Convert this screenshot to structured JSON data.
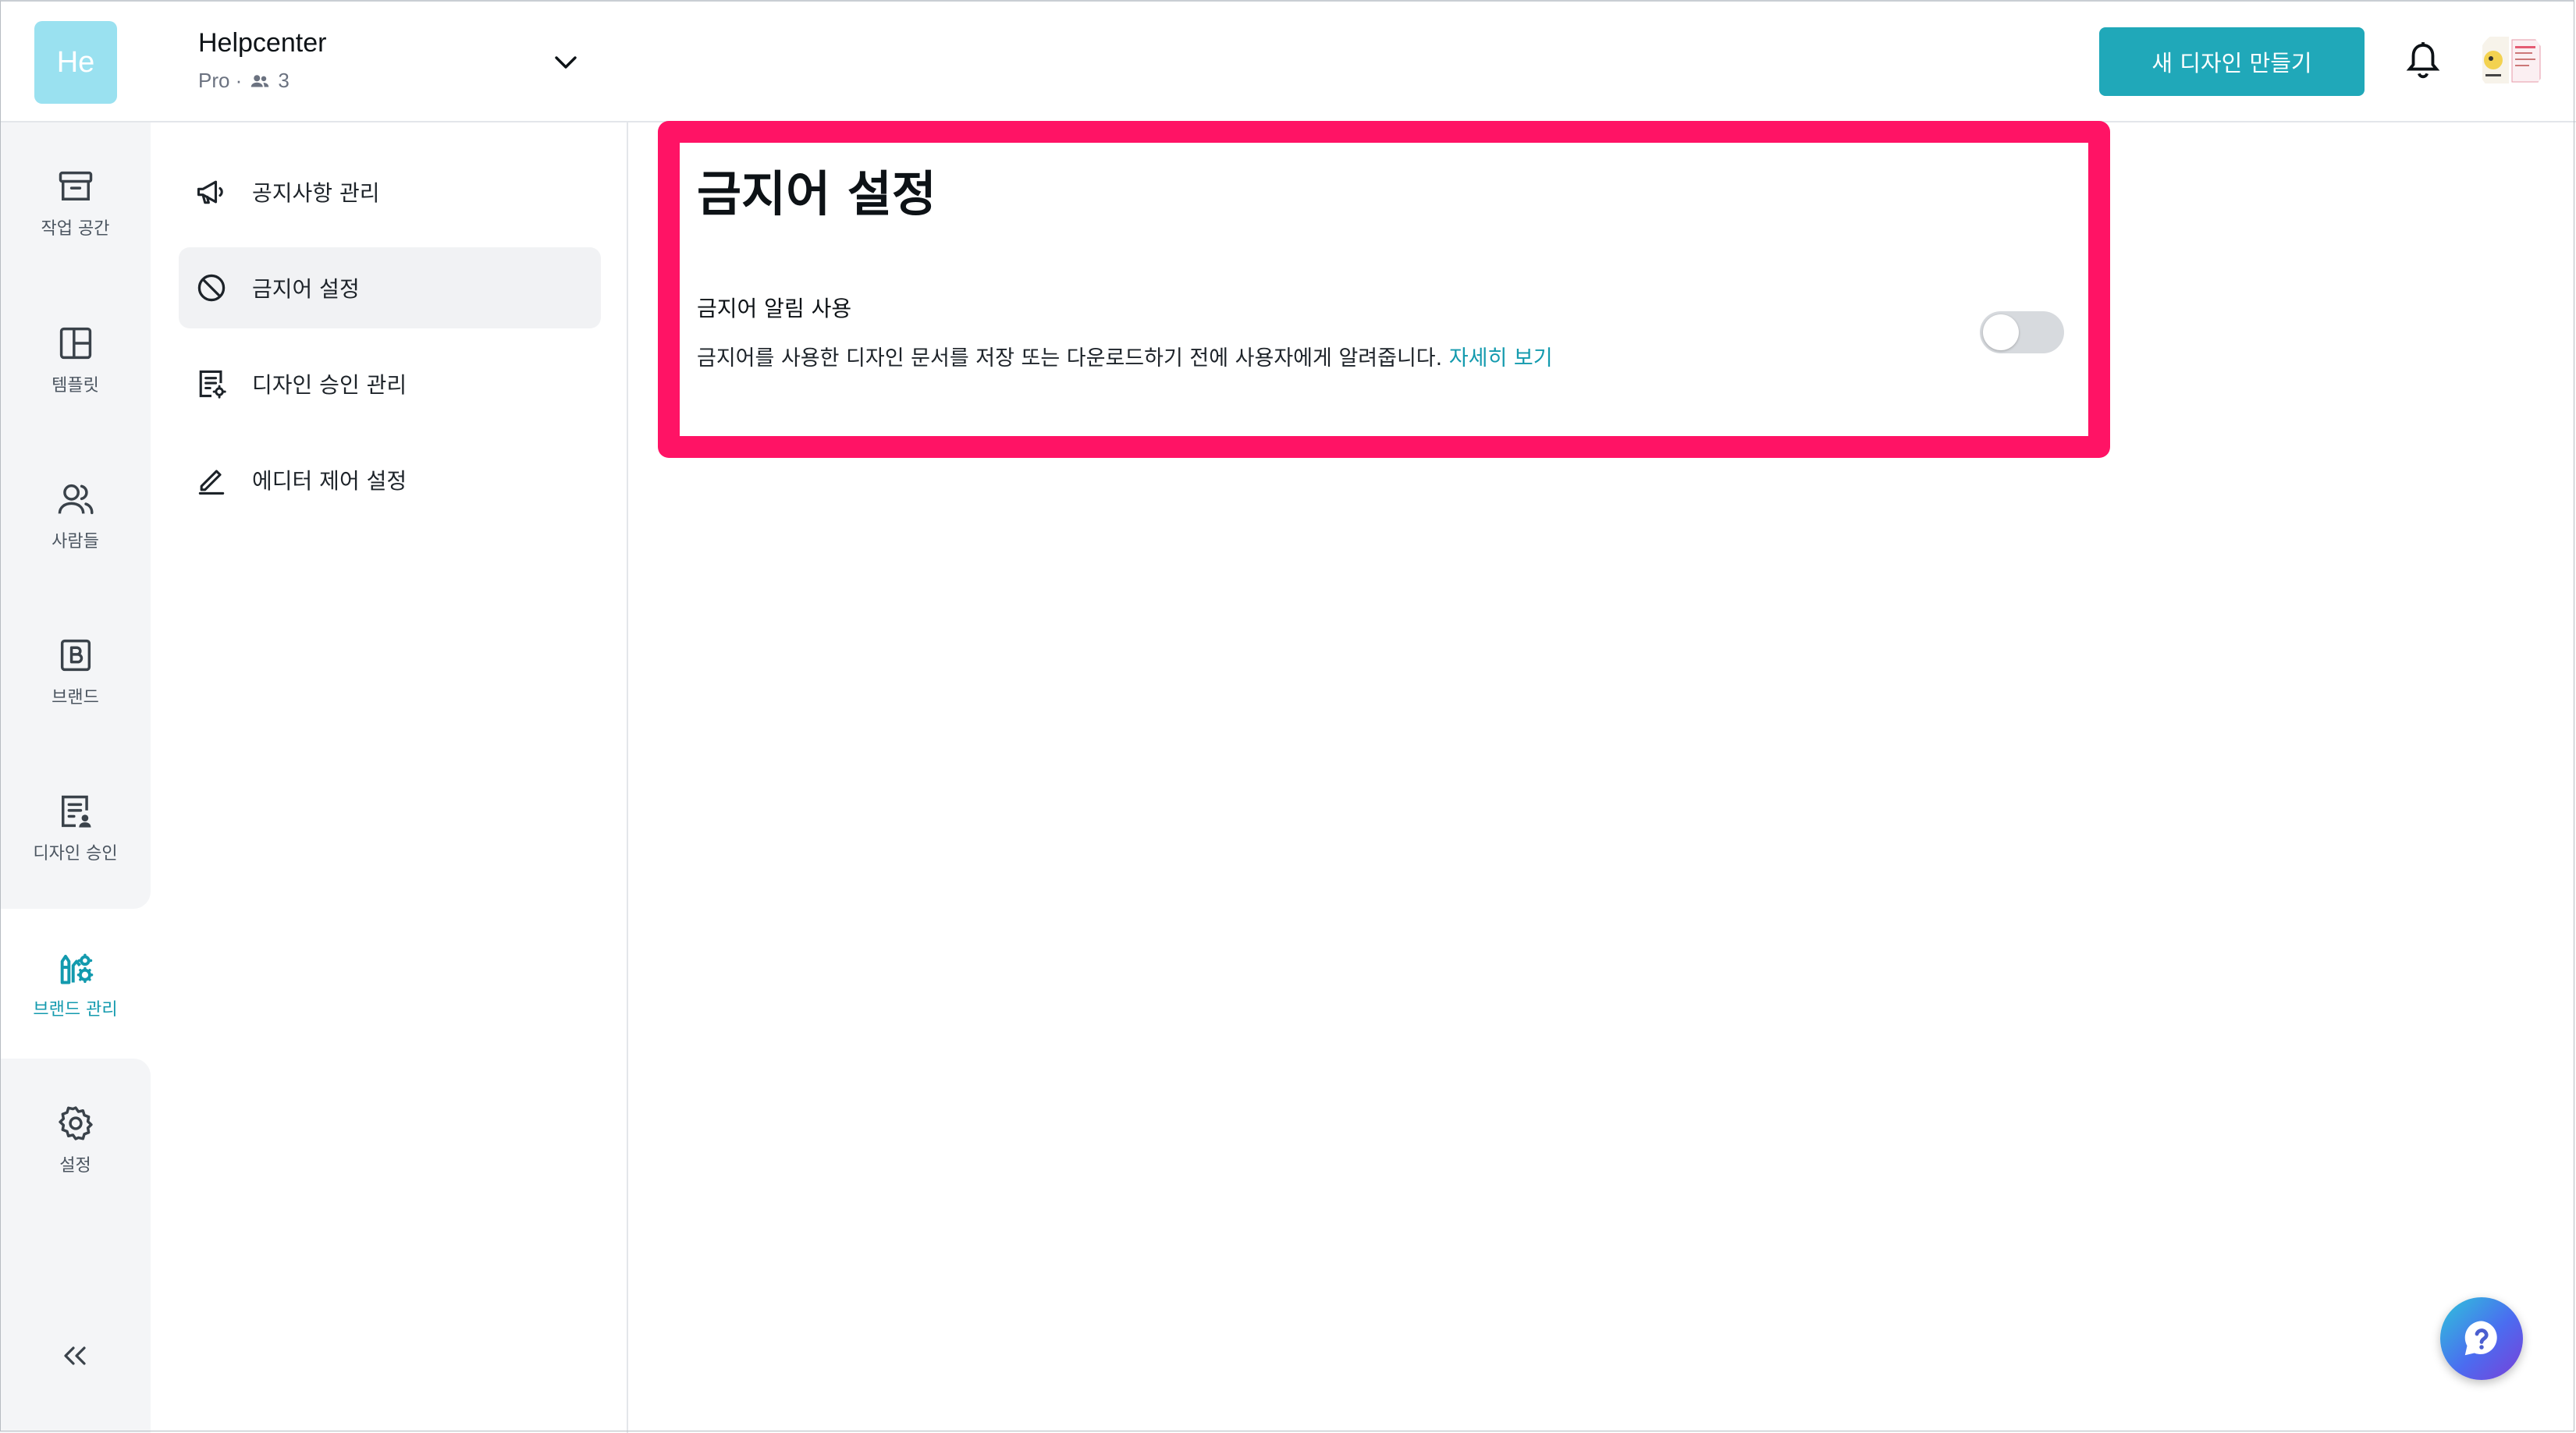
{
  "header": {
    "team_logo_text": "He",
    "team_name": "Helpcenter",
    "team_plan": "Pro ·",
    "team_member_count": "3",
    "create_button_label": "새 디자인 만들기"
  },
  "rail": {
    "items": [
      {
        "label": "작업 공간",
        "icon": "archive-box-icon"
      },
      {
        "label": "템플릿",
        "icon": "template-layout-icon"
      },
      {
        "label": "사람들",
        "icon": "people-icon"
      },
      {
        "label": "브랜드",
        "icon": "brand-b-icon"
      },
      {
        "label": "디자인 승인",
        "icon": "design-approval-icon"
      },
      {
        "label": "브랜드 관리",
        "icon": "brand-management-icon",
        "active": true
      },
      {
        "label": "설정",
        "icon": "gear-icon"
      }
    ]
  },
  "submenu": {
    "items": [
      {
        "label": "공지사항 관리",
        "icon": "megaphone-icon"
      },
      {
        "label": "금지어 설정",
        "icon": "prohibited-icon",
        "active": true
      },
      {
        "label": "디자인 승인 관리",
        "icon": "document-gear-icon"
      },
      {
        "label": "에디터 제어 설정",
        "icon": "pencil-icon"
      }
    ]
  },
  "main": {
    "title": "금지어 설정",
    "setting_label": "금지어 알림 사용",
    "setting_description": "금지어를 사용한 디자인 문서를 저장 또는 다운로드하기 전에 사용자에게 알려줍니다.",
    "setting_link": "자세히 보기",
    "toggle_enabled": false
  },
  "colors": {
    "accent": "#20a8b9",
    "highlight_border": "#ff1365",
    "active_text": "#139aae"
  }
}
